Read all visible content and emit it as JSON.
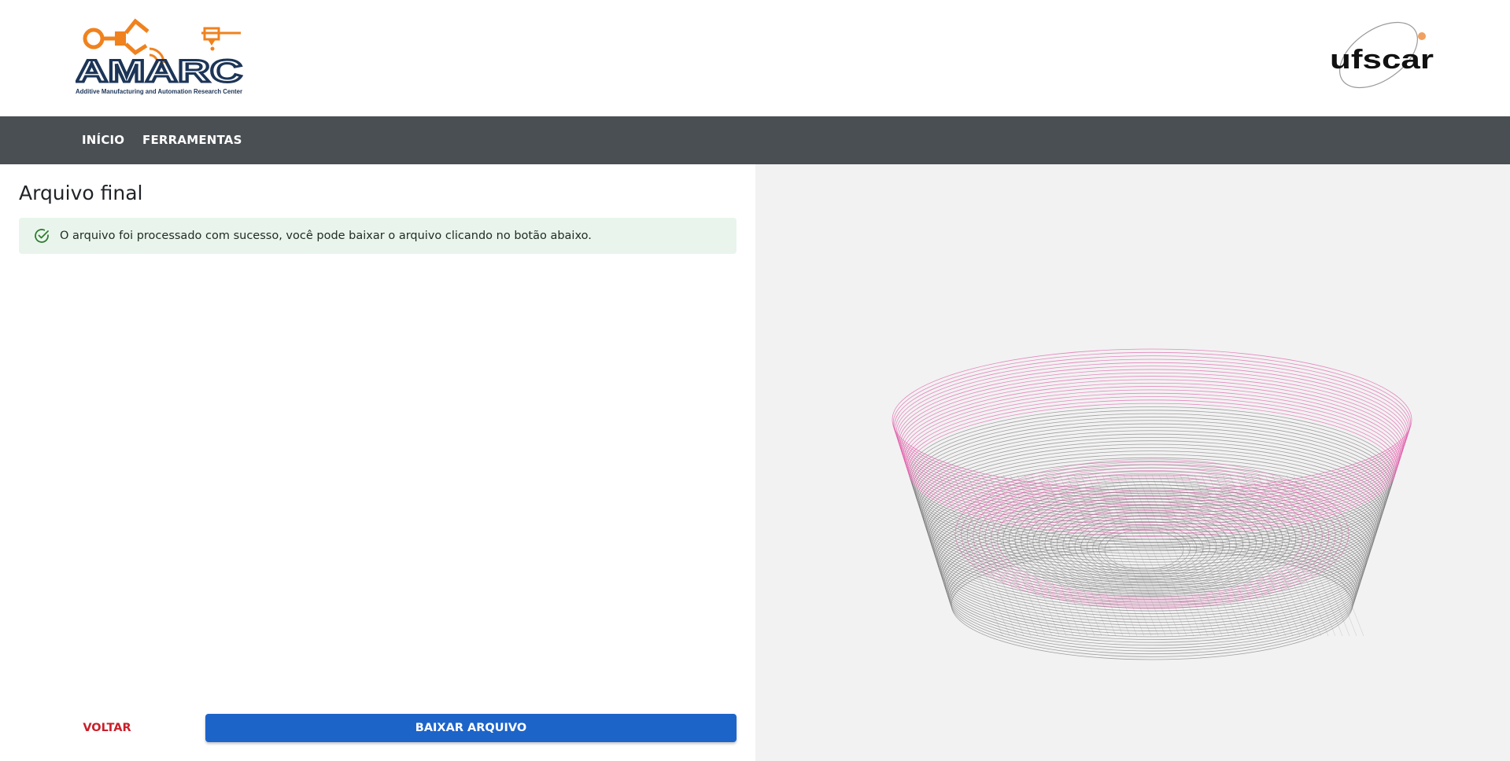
{
  "header": {
    "amarc_logo": {
      "wordmark": "AMARC",
      "tagline": "Additive Manufacturing and Automation Research Center"
    },
    "ufscar_logo": {
      "wordmark": "ufscar"
    }
  },
  "nav": {
    "items": [
      {
        "label": "INÍCIO"
      },
      {
        "label": "FERRAMENTAS"
      }
    ]
  },
  "main": {
    "title": "Arquivo final",
    "alert": {
      "icon": "check-circle-icon",
      "text": "O arquivo foi processado com sucesso, você pode baixar o arquivo clicando no botão abaixo."
    },
    "back_label": "VOLTAR",
    "download_label": "BAIXAR ARQUIVO"
  },
  "viewer": {
    "colors": {
      "background": "#f2f2f2",
      "toolpath": "#7a7a7a",
      "highlight": "#e05aa8"
    }
  },
  "colors": {
    "navbar": "#4a4f53",
    "primary": "#1d64c9",
    "danger": "#c8202b",
    "success_bg": "#e9f5ec",
    "brand_orange": "#f0821e",
    "brand_navy": "#1c3557"
  }
}
